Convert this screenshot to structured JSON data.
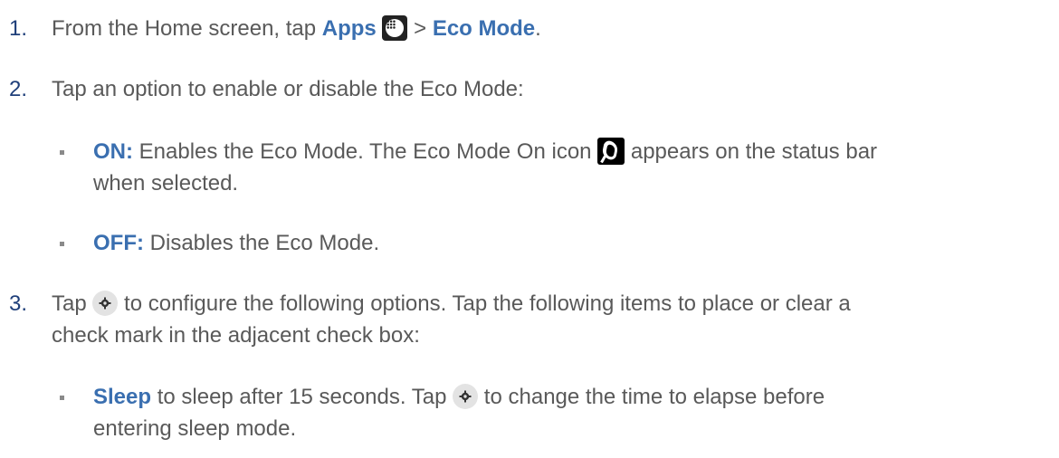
{
  "steps": [
    {
      "number": "1.",
      "text_before": "From the Home screen, tap ",
      "bold1": "Apps",
      "sep": " > ",
      "bold2": "Eco Mode",
      "end": "."
    },
    {
      "number": "2.",
      "text": "Tap an option to enable or disable the Eco Mode:"
    },
    {
      "number": "3.",
      "text_before": "Tap ",
      "text_after": " to configure the following options. Tap the following items to place or clear a",
      "line2": "check mark in the adjacent check box:"
    }
  ],
  "bullets": {
    "on": {
      "label": "ON:",
      "text_before": " Enables the Eco Mode. The Eco Mode On icon ",
      "text_after": " appears on the status bar",
      "line2": "when selected."
    },
    "off": {
      "label": "OFF:",
      "text": " Disables the Eco Mode."
    },
    "sleep": {
      "label": "Sleep",
      "text_before": " to sleep after 15 seconds. Tap ",
      "text_after": " to change the time to elapse before",
      "line2": "entering sleep mode."
    }
  },
  "icons": {
    "apps": "apps-icon",
    "eco_mode_on": "eco-mode-on-icon",
    "settings": "gear-icon"
  },
  "colors": {
    "text": "#595959",
    "bold": "#3a6fb0",
    "number": "#1f3f7a"
  }
}
